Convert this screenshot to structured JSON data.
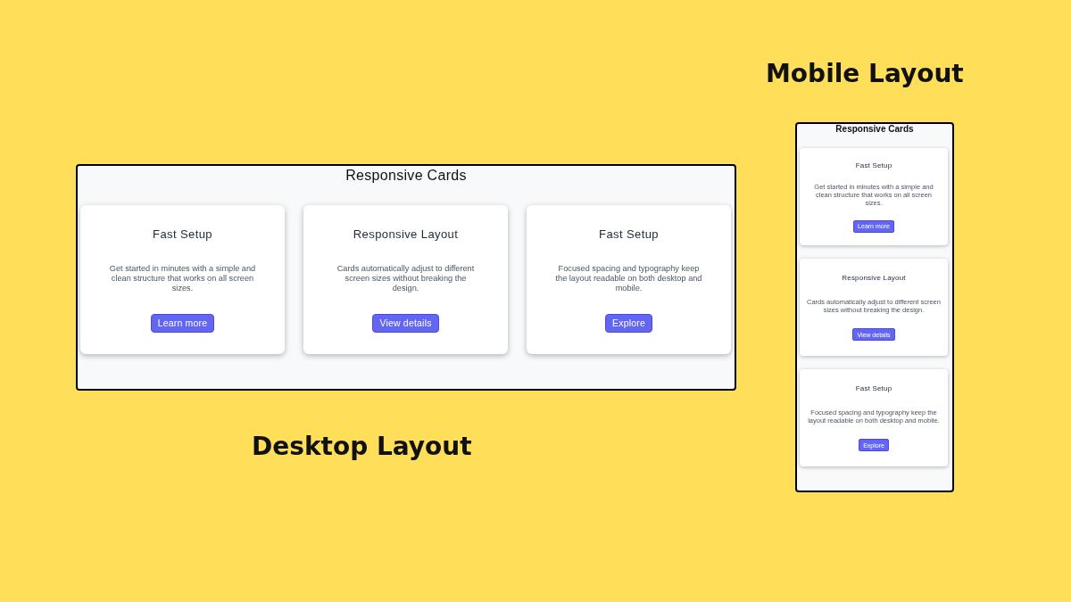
{
  "desktop": {
    "title": "Responsive Cards",
    "cards": [
      {
        "title": "Fast Setup",
        "description": "Get started in minutes with a simple and clean structure that works on all screen sizes.",
        "button": "Learn more"
      },
      {
        "title": "Responsive Layout",
        "description": "Cards automatically adjust to different screen sizes without breaking the design.",
        "button": "View details"
      },
      {
        "title": "Fast Setup",
        "description": "Focused spacing and typography keep the layout readable on both desktop and mobile.",
        "button": "Explore"
      }
    ]
  },
  "desktop_caption": "Desktop Layout",
  "mobile_caption": "Mobile Layout",
  "mobile": {
    "title": "Responsive Cards",
    "cards": [
      {
        "title": "Fast Setup",
        "description": "Get started in minutes with a simple and clean structure that works on all screen sizes.",
        "button": "Learn more"
      },
      {
        "title": "Responsive Layout",
        "description": "Cards automatically adjust to different screen sizes without breaking the design.",
        "button": "View details"
      },
      {
        "title": "Fast Setup",
        "description": "Focused spacing and typography keep the layout readable on both desktop and mobile.",
        "button": "Explore"
      }
    ]
  }
}
